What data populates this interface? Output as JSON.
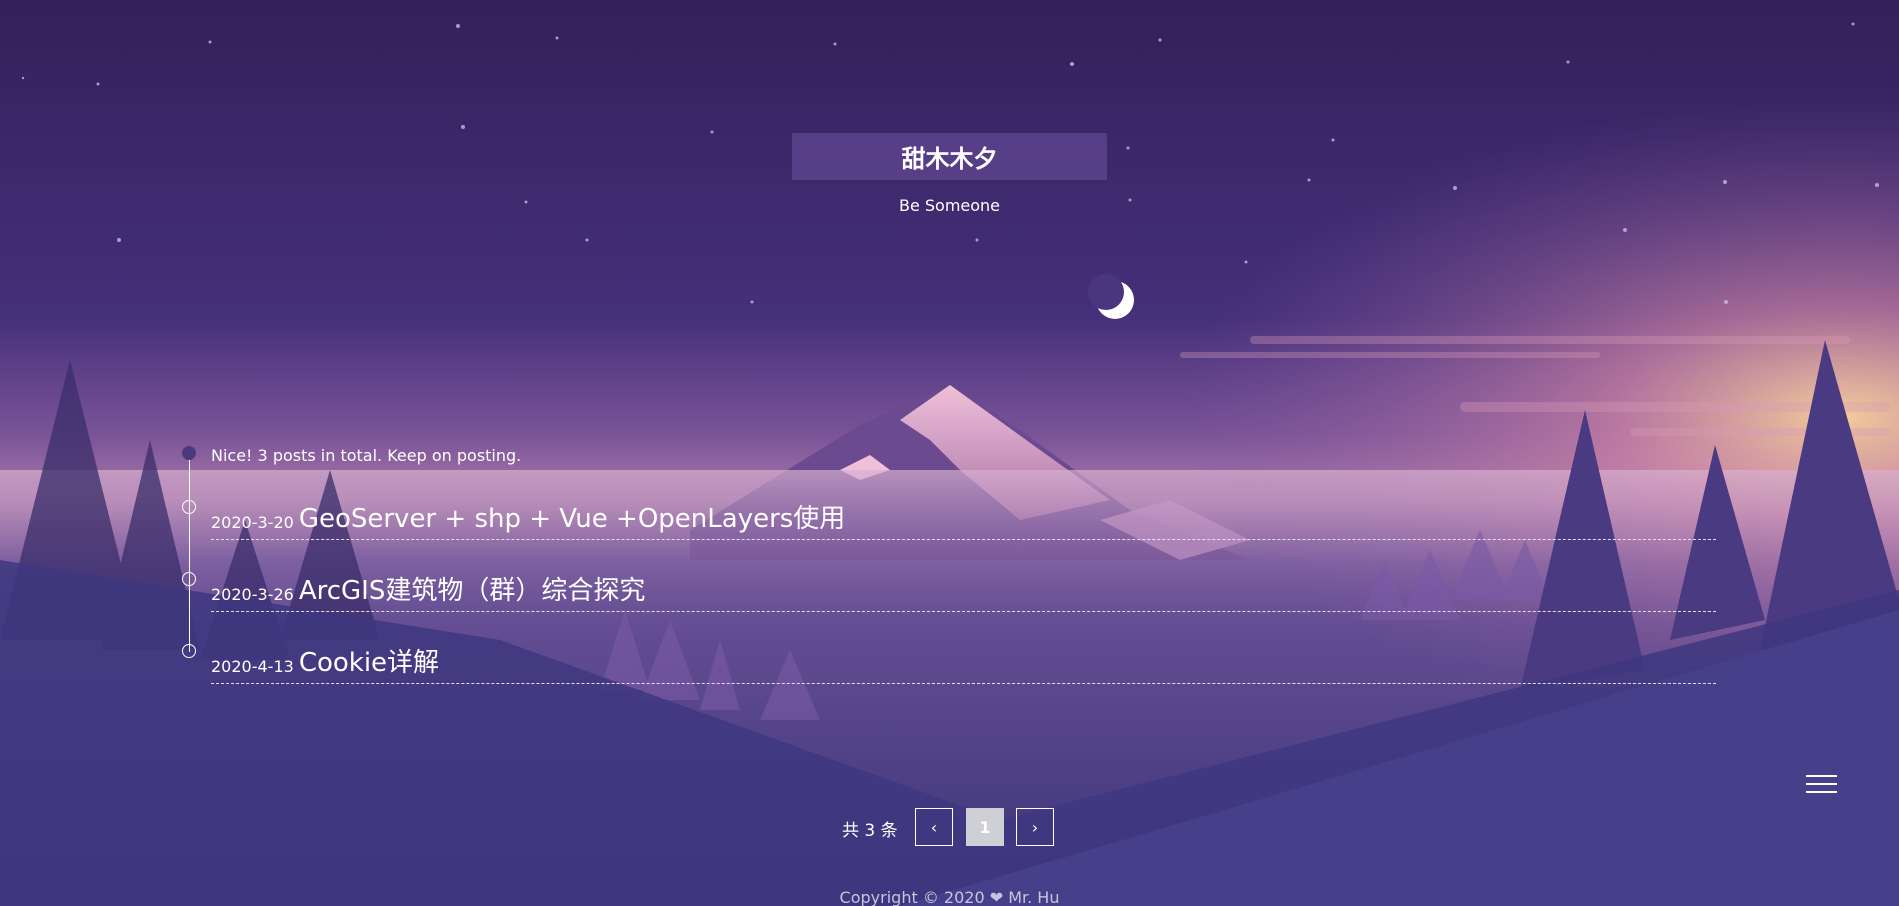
{
  "site": {
    "title": "甜木木夕",
    "subtitle": "Be Someone"
  },
  "archive": {
    "summary": "Nice! 3 posts in total. Keep on posting.",
    "posts": [
      {
        "date": "2020-3-20",
        "title": "GeoServer + shp + Vue +OpenLayers使用"
      },
      {
        "date": "2020-3-26",
        "title": "ArcGIS建筑物（群）综合探究"
      },
      {
        "date": "2020-4-13",
        "title": "Cookie详解"
      }
    ]
  },
  "pagination": {
    "total_label": "共 3 条",
    "prev_icon": "‹",
    "current_page": "1",
    "next_icon": "›"
  },
  "footer": {
    "copyright": "Copyright © 2020 ❤ Mr. Hu"
  },
  "icons": {
    "menu": "hamburger-menu-icon",
    "moon": "crescent-moon-icon"
  },
  "colors": {
    "sky_top": "#3a2460",
    "horizon": "#e8a0b0",
    "mountain": "#5a3a80",
    "active_page": "#cfcfd6"
  }
}
